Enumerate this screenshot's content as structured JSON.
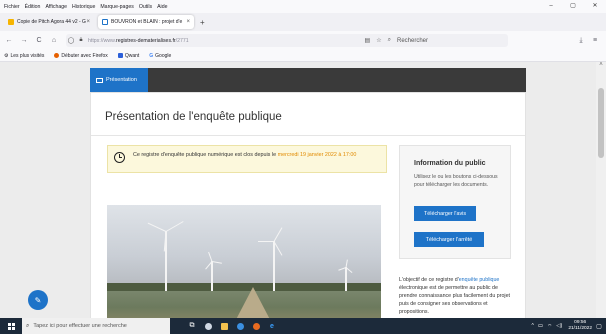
{
  "menubar": {
    "items": [
      "Fichier",
      "Édition",
      "Affichage",
      "Historique",
      "Marque-pages",
      "Outils",
      "Aide"
    ]
  },
  "window_controls": {
    "minimize": "–",
    "maximize": "▢",
    "close": "✕"
  },
  "tabs": [
    {
      "label": "Copie de Pitch Agora 44 v2 - G",
      "active": false
    },
    {
      "label": "BOUVRON et BLAIN : projet d'e",
      "active": true
    }
  ],
  "new_tab": "+",
  "nav": {
    "back": "←",
    "forward": "→",
    "reload": "C",
    "home": "⌂",
    "url_prefix": "https://www.",
    "url_domain": "registres-dematerialises.fr",
    "url_path": "/2771",
    "search_placeholder": "Rechercher",
    "reader": "▤",
    "bookmark_star": "☆",
    "downloads": "⤓",
    "menu": "≡"
  },
  "bookmarks": [
    {
      "label": "Les plus visités",
      "icon": "gear-icon"
    },
    {
      "label": "Débuter avec Firefox",
      "icon": "firefox-icon"
    },
    {
      "label": "Qwant",
      "icon": "qwant-icon"
    },
    {
      "label": "Google",
      "icon": "google-icon"
    }
  ],
  "page": {
    "nav_tab": "Présentation",
    "title": "Présentation de l'enquête publique",
    "notice_text": "Ce registre d'enquête publique numérique est clos depuis le ",
    "notice_date": "mercredi 19 janvier 2022 à 17:00",
    "info": {
      "title": "Information du public",
      "text": "Utilisez le ou les boutons ci-dessous pour télécharger les documents.",
      "btn_avis": "Télécharger l'avis",
      "btn_arrete": "Télécharger l'arrêté"
    },
    "objective": {
      "pre": "L'objectif de ce registre d'",
      "link": "enquête publique",
      "post": " électronique est de permettre au public de prendre connaissance plus facilement du projet puis de consigner ses observations et propositions."
    }
  },
  "taskbar": {
    "search_placeholder": "Tapez ici pour effectuer une recherche",
    "tray": "^",
    "time": "09:56",
    "date": "21/11/2022"
  },
  "colors": {
    "accent": "#1e73c8",
    "highlight": "#e18a00",
    "notice_bg": "#fcf8dc"
  }
}
